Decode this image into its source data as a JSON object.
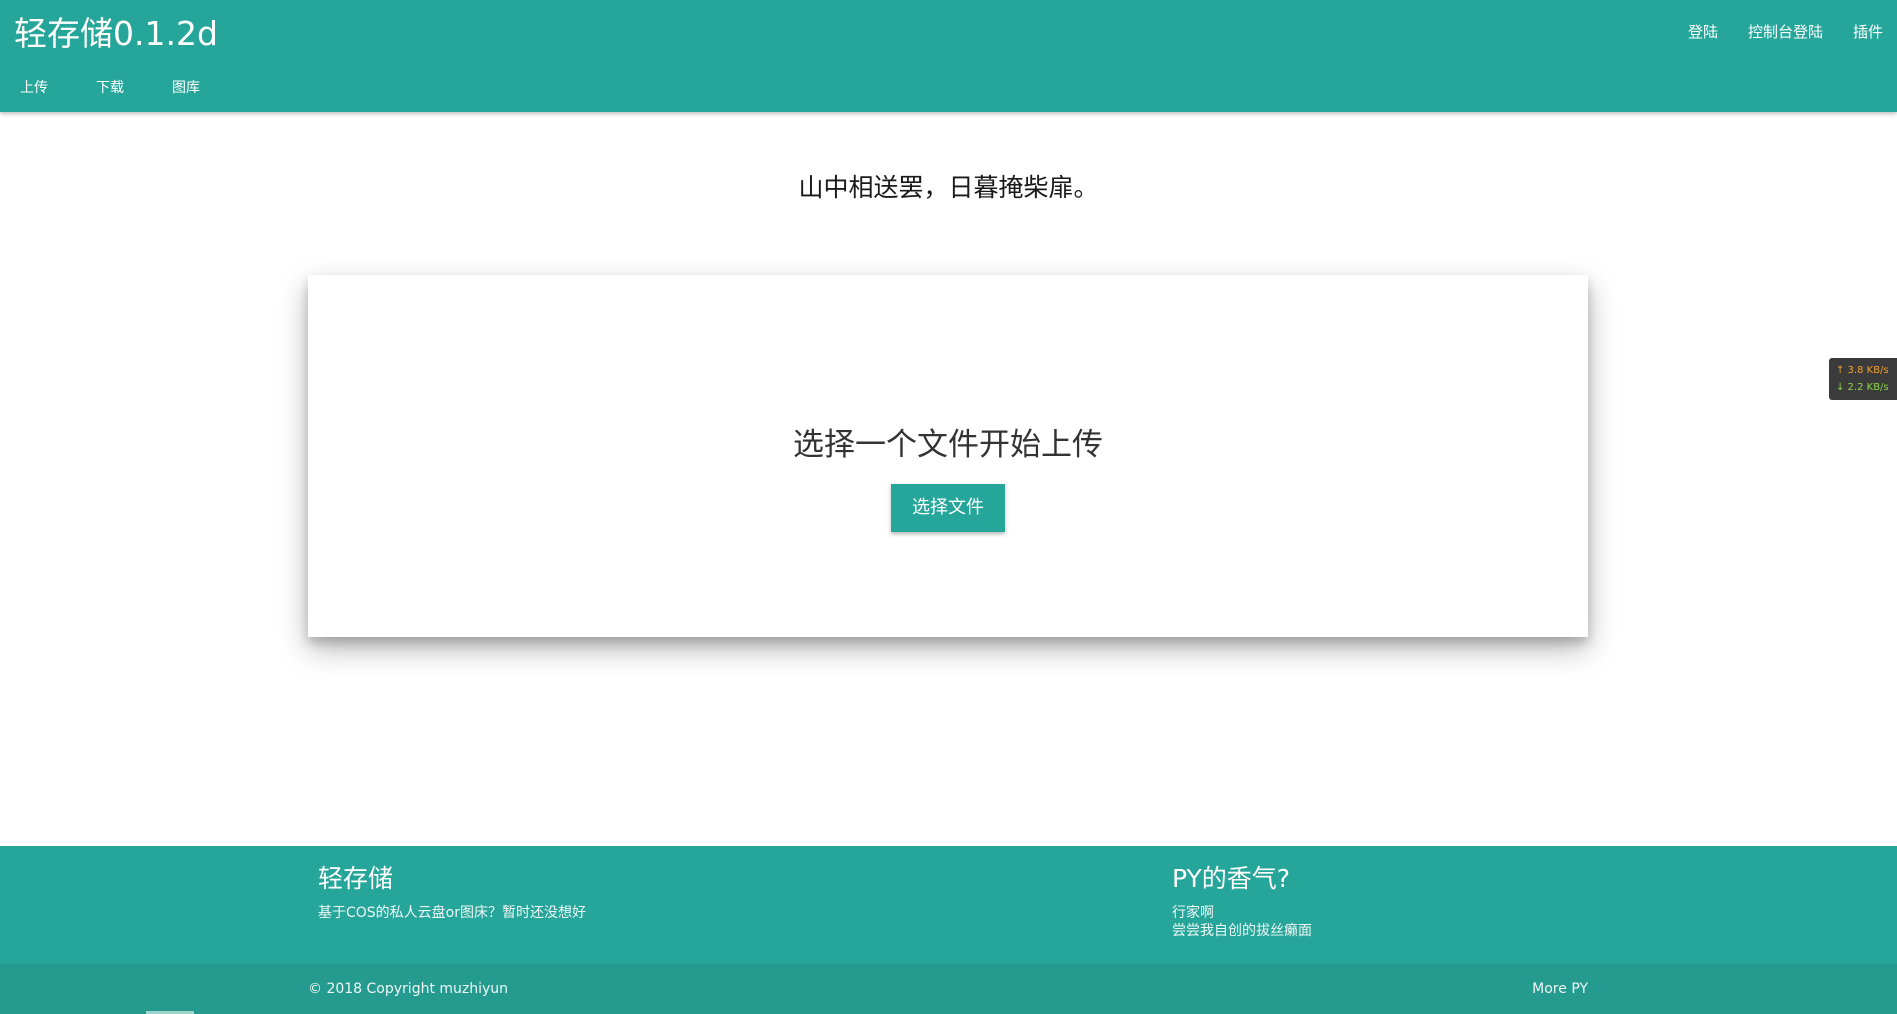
{
  "header": {
    "brand": "轻存储0.1.2d",
    "top_links": [
      "登陆",
      "控制台登陆",
      "插件"
    ],
    "tabs": [
      "上传",
      "下载",
      "图库"
    ]
  },
  "main": {
    "poem": "山中相送罢，日暮掩柴扉。",
    "upload_card": {
      "title": "选择一个文件开始上传",
      "button_label": "选择文件"
    }
  },
  "speed_widget": {
    "upload": "↑ 3.8 KB/s",
    "download": "↓ 2.2 KB/s"
  },
  "footer": {
    "left_title": "轻存储",
    "left_desc": "基于COS的私人云盘or图床？暂时还没想好",
    "right_title": "PY的香气?",
    "right_line1": "行家啊",
    "right_line2": "尝尝我自创的拔丝癞面",
    "copyright": "© 2018 Copyright muzhiyun",
    "more_link": "More PY"
  },
  "colors": {
    "primary": "#26a69a",
    "footer_bottom": "#259b90"
  }
}
